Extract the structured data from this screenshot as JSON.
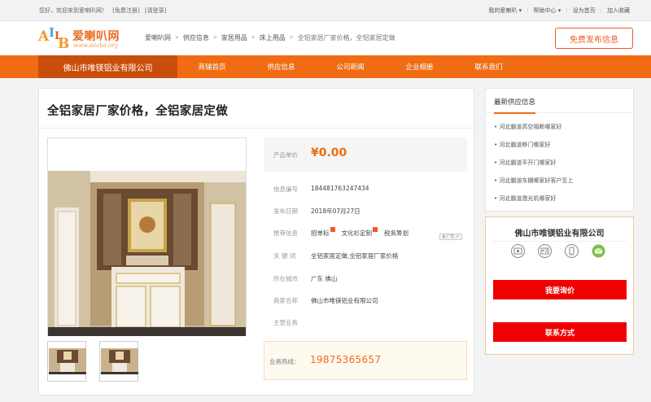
{
  "topbar": {
    "welcome": "您好，欢迎来到爱喇叭网！",
    "register": "[免费注册]",
    "login": "[请登录]",
    "my_account": "我的爱喇叭 ▾",
    "help": "帮助中心 ▾",
    "set_home": "设为首页",
    "favorite": "加入收藏"
  },
  "logo": {
    "mark_letters": [
      "A",
      "I",
      "L",
      "B"
    ],
    "name": "爱喇叭网",
    "domain": "www.ailaba.org"
  },
  "breadcrumb": [
    {
      "label": "爱喇叭网"
    },
    {
      "label": "供应信息"
    },
    {
      "label": "家居用品"
    },
    {
      "label": "床上用品"
    },
    {
      "label": "全铝家居厂家价格，全铝家居定做"
    }
  ],
  "breadcrumb_sep": "»",
  "publish_button": "免费发布信息",
  "nav": {
    "company": "佛山市唯镁铝业有限公司",
    "items": [
      "商铺首页",
      "供应信息",
      "公司新闻",
      "企业相册",
      "联系我们"
    ]
  },
  "product": {
    "title": "全铝家居厂家价格，全铝家居定做",
    "price_label": "产品单价",
    "price": "¥0.00",
    "fields": [
      {
        "label": "信息编号",
        "value": "184481763247434"
      },
      {
        "label": "发布日期",
        "value": "2018年07月27日"
      }
    ],
    "recommend_label": "推荐信息",
    "recommend": [
      "招单标",
      "文化衫定制",
      "税务筹划"
    ],
    "ad_mark": "◐广告 ×",
    "keywords_label": "关 键 词",
    "keywords": "全铝家居定做,全铝家居厂家价格",
    "city_label": "所在城市",
    "city": "广东 佛山",
    "merchant_label": "商家名称",
    "merchant": "佛山市唯镁铝业有限公司",
    "business_label": "主营业务",
    "business": "",
    "hotline_label": "业务热线：",
    "hotline": "19875365657"
  },
  "latest": {
    "title": "最新供应信息",
    "items": [
      "• 河北霸道高空隔断哪家好",
      "• 河北霸道移门哪家好",
      "• 河北霸道平开门哪家好",
      "• 河北霸道车棚哪家好客户至上",
      "• 河北霸道激光机哪家好"
    ]
  },
  "company_card": {
    "name": "佛山市唯镁铝业有限公司",
    "inquiry_button": "我要询价",
    "contact_button": "联系方式"
  },
  "colors": {
    "accent": "#f06c14",
    "accent_dark": "#c94e0c",
    "button_red": "#f00000",
    "price": "#f06c14"
  }
}
